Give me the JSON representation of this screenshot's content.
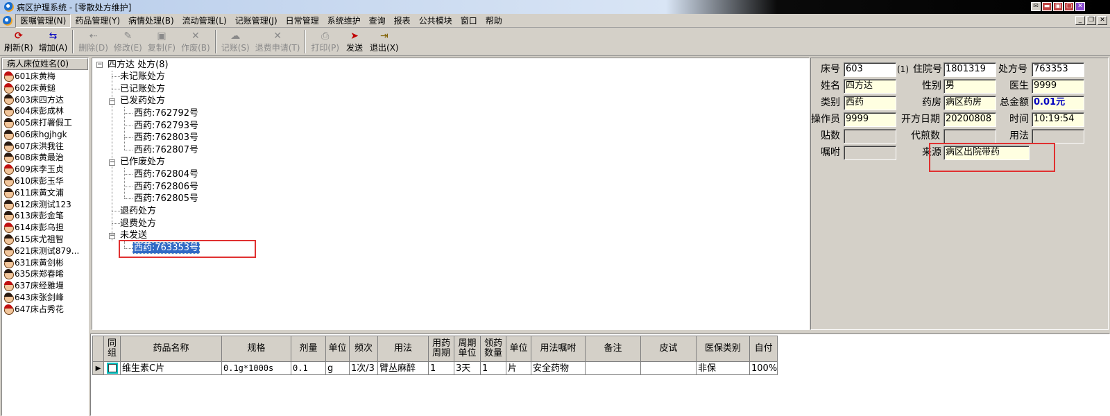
{
  "window": {
    "title": "病区护理系统 - [零散处方维护]"
  },
  "menu": [
    "医嘱管理(N)",
    "药品管理(Y)",
    "病情处理(B)",
    "流动管理(L)",
    "记账管理(J)",
    "日常管理",
    "系统维护",
    "查询",
    "报表",
    "公共模块",
    "窗口",
    "帮助"
  ],
  "toolbar": [
    {
      "label": "刷新(R)",
      "icon": "refresh-icon",
      "enabled": true
    },
    {
      "label": "增加(A)",
      "icon": "add-icon",
      "enabled": true
    },
    {
      "label": "删除(D)",
      "icon": "delete-icon",
      "enabled": false
    },
    {
      "label": "修改(E)",
      "icon": "edit-icon",
      "enabled": false
    },
    {
      "label": "复制(F)",
      "icon": "copy-icon",
      "enabled": false
    },
    {
      "label": "作废(B)",
      "icon": "void-icon",
      "enabled": false
    },
    {
      "label": "记账(S)",
      "icon": "charge-icon",
      "enabled": false
    },
    {
      "label": "退费申请(T)",
      "icon": "refund-icon",
      "enabled": false
    },
    {
      "label": "打印(P)",
      "icon": "print-icon",
      "enabled": false
    },
    {
      "label": "发送",
      "icon": "send-icon",
      "enabled": true
    },
    {
      "label": "退出(X)",
      "icon": "exit-icon",
      "enabled": true
    }
  ],
  "patients": {
    "header": "病人床位姓名(0)",
    "items": [
      {
        "label": "601床黄梅",
        "red": true
      },
      {
        "label": "602床黄鎚",
        "red": true
      },
      {
        "label": "603床四方达",
        "red": false
      },
      {
        "label": "604床彭成林",
        "red": false
      },
      {
        "label": "605床打署假工",
        "red": false
      },
      {
        "label": "606床hgjhgk",
        "red": false
      },
      {
        "label": "607床洪我往",
        "red": false
      },
      {
        "label": "608床黄最治",
        "red": false
      },
      {
        "label": "609床李玉贞",
        "red": true
      },
      {
        "label": "610床彭玉华",
        "red": false
      },
      {
        "label": "611床黄文浦",
        "red": false
      },
      {
        "label": "612床测试123",
        "red": false
      },
      {
        "label": "613床彭金笔",
        "red": false
      },
      {
        "label": "614床彭乌担",
        "red": true
      },
      {
        "label": "615床尤祖智",
        "red": false
      },
      {
        "label": "621床测试879...",
        "red": false
      },
      {
        "label": "631床黄剑彬",
        "red": false
      },
      {
        "label": "635床郑春晞",
        "red": false
      },
      {
        "label": "637床经雅墁",
        "red": true
      },
      {
        "label": "643床张剑峰",
        "red": false
      },
      {
        "label": "647床占秀花",
        "red": true
      }
    ]
  },
  "tree": {
    "root": "四方达 处方(8)",
    "n_unposted": "未记账处方",
    "n_posted": "已记账处方",
    "n_dispensed": "已发药处方",
    "dispensed": [
      "西药:762792号",
      "西药:762793号",
      "西药:762803号",
      "西药:762807号"
    ],
    "n_voided": "已作废处方",
    "voided": [
      "西药:762804号",
      "西药:762806号",
      "西药:762805号"
    ],
    "n_returned": "退药处方",
    "n_refunded": "退费处方",
    "n_unsent": "未发送",
    "unsent": [
      "西药:763353号"
    ]
  },
  "form": {
    "bed_label": "床号",
    "bed": "603",
    "bed_note": "(1)",
    "admission_label": "住院号",
    "admission": "1801319",
    "rx_label": "处方号",
    "rx": "763353",
    "name_label": "姓名",
    "name": "四方达",
    "sex_label": "性别",
    "sex": "男",
    "doctor_label": "医生",
    "doctor": "9999",
    "type_label": "类别",
    "type": "西药",
    "pharmacy_label": "药房",
    "pharmacy": "病区药房",
    "total_label": "总金额",
    "total": "0.01元",
    "operator_label": "操作员",
    "operator": "9999",
    "date_label": "开方日期",
    "date": "20200808",
    "time_label": "时间",
    "time": "10:19:54",
    "doses_label": "贴数",
    "decoct_label": "代煎数",
    "usage_label": "用法",
    "advice_label": "嘱咐",
    "source_label": "来源",
    "source": "病区出院带药"
  },
  "grid": {
    "headers": [
      "同组",
      "药品名称",
      "规格",
      "剂量",
      "单位",
      "频次",
      "用法",
      "用药周期",
      "周期单位",
      "领药数量",
      "单位",
      "用法嘱咐",
      "备注",
      "皮试",
      "医保类别",
      "自付"
    ],
    "rows": [
      [
        "",
        "维生素C片",
        "0.1g*1000s",
        "0.1",
        "g",
        "1次/3",
        "臂丛麻醉",
        "1",
        "3天",
        "1",
        "片",
        "安全药物",
        "",
        "",
        "非保",
        "100%"
      ]
    ]
  }
}
